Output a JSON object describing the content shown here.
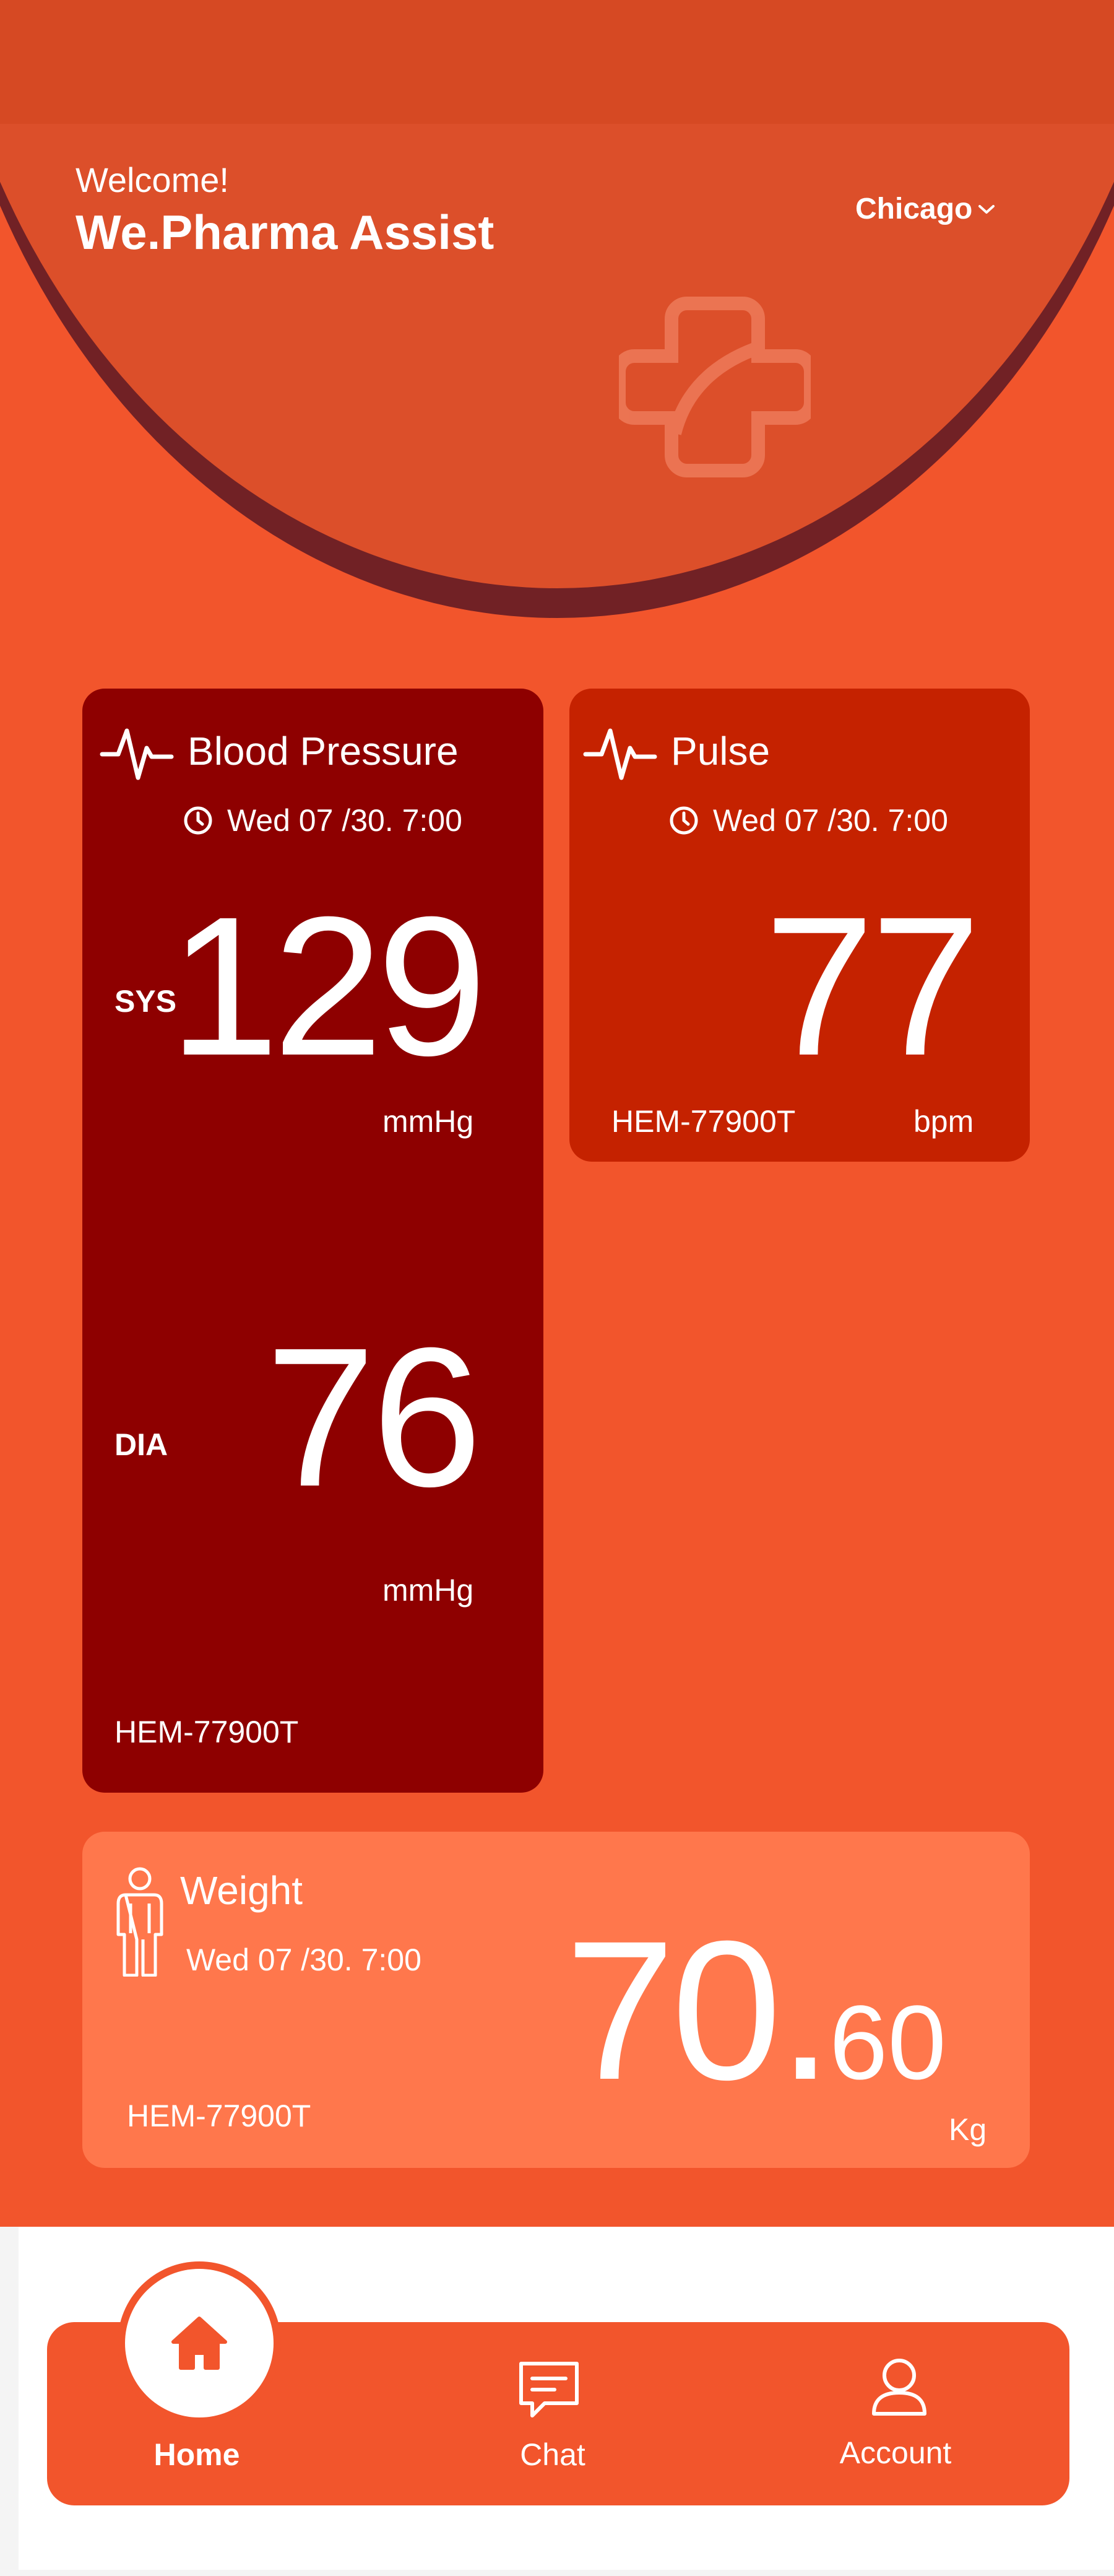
{
  "header": {
    "greeting": "Welcome!",
    "app_name": "We.Pharma Assist",
    "location": "Chicago"
  },
  "blood_pressure": {
    "title": "Blood Pressure",
    "timestamp": "Wed 07 /30. 7:00",
    "sys_label": "SYS",
    "sys_value": "129",
    "sys_unit": "mmHg",
    "dia_label": "DIA",
    "dia_value": "76",
    "dia_unit": "mmHg",
    "device": "HEM-77900T"
  },
  "pulse": {
    "title": "Pulse",
    "timestamp": "Wed 07 /30. 7:00",
    "value": "77",
    "device": "HEM-77900T",
    "unit": "bpm"
  },
  "weight": {
    "title": "Weight",
    "timestamp": "Wed 07 /30. 7:00",
    "value_int": "70.",
    "value_dec": "60",
    "unit": "Kg",
    "device": "HEM-77900T"
  },
  "nav": {
    "home": "Home",
    "chat": "Chat",
    "account": "Account"
  },
  "colors": {
    "background": "#F2552C",
    "blood_pressure_card": "#8E0000",
    "pulse_card": "#C52200",
    "weight_card": "#FF774C"
  },
  "icons": [
    "heartbeat-icon",
    "clock-icon",
    "person-icon",
    "home-icon",
    "chat-icon",
    "account-icon",
    "chevron-down-icon",
    "cross-logo-icon"
  ]
}
